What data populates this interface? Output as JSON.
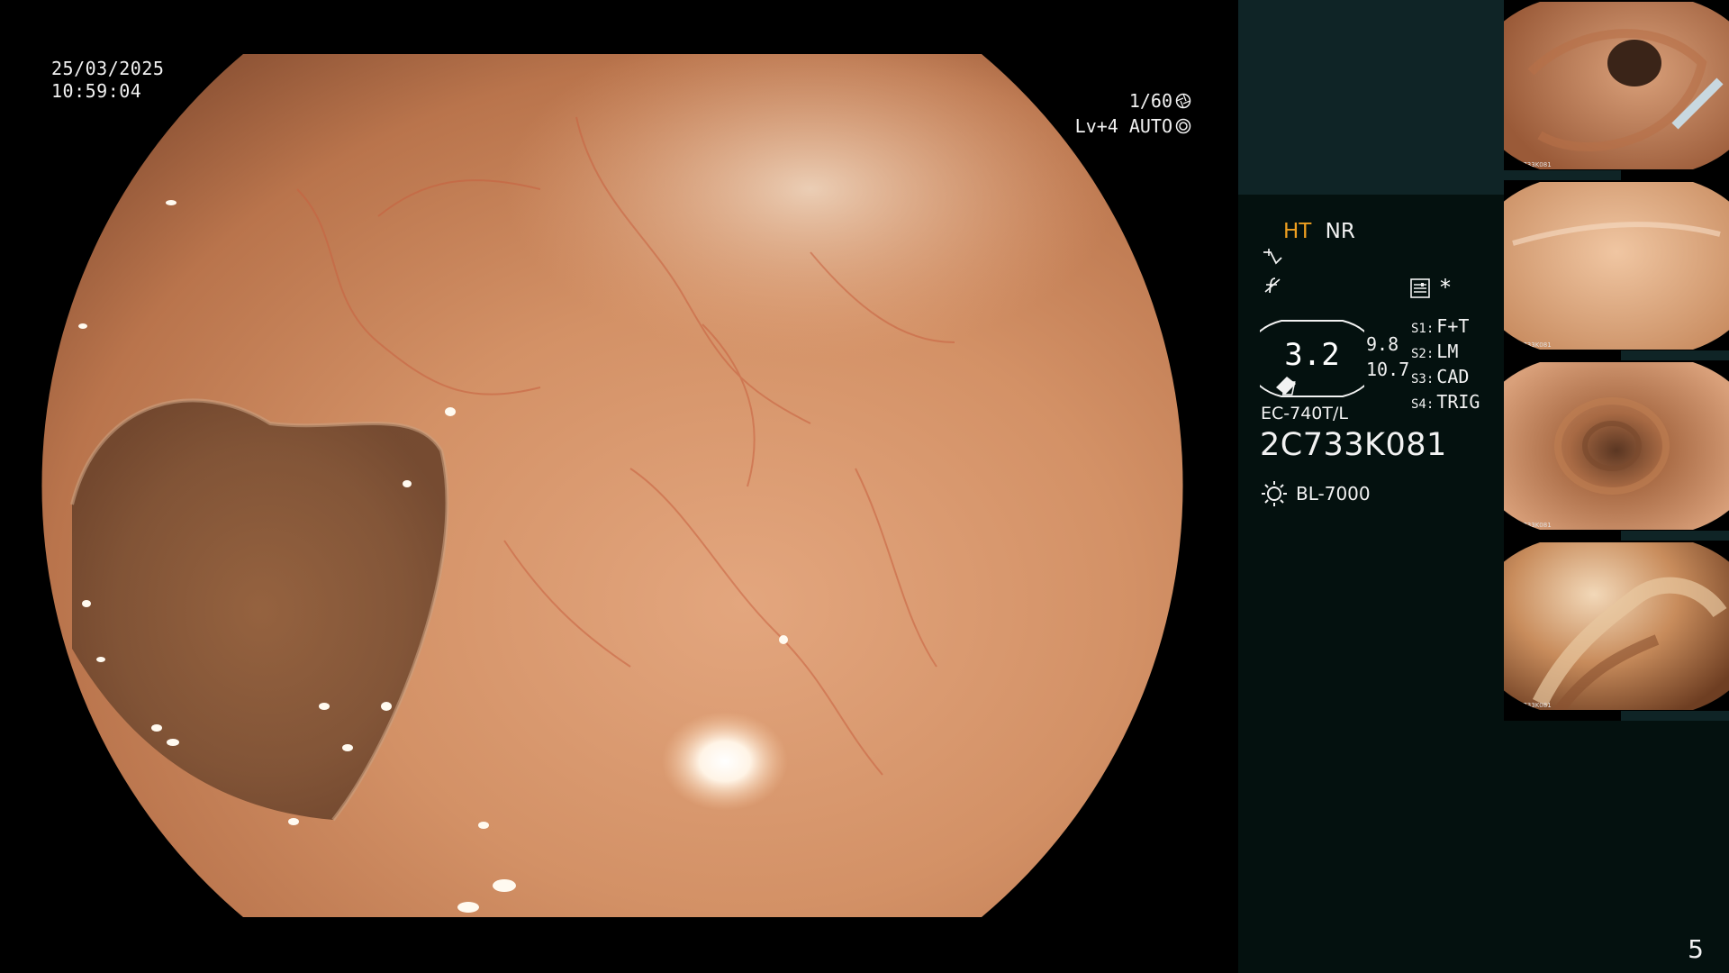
{
  "main": {
    "date": "25/03/2025",
    "time": "10:59:04",
    "shutter": "1/60",
    "shutter_icon": "aperture-icon",
    "level": "Lv+4",
    "mode": "AUTO",
    "mode_icon": "iris-icon"
  },
  "side": {
    "header_color": "#0f2426",
    "panel_color": "#04110f",
    "mode_ht": "HT",
    "mode_nr": "NR",
    "ht_color": "#f0a020",
    "icons": [
      "wave-icon",
      "f-not-icon",
      "menu-list-icon"
    ],
    "star": "*",
    "gauge_value": "3.2",
    "gauge_top": "9.8",
    "gauge_bottom": "10.7",
    "switches": [
      {
        "key": "S1:",
        "value": "F+T"
      },
      {
        "key": "S2:",
        "value": "LM"
      },
      {
        "key": "S3:",
        "value": "CAD"
      },
      {
        "key": "S4:",
        "value": "TRIG"
      }
    ],
    "scope_model": "EC-740T/L",
    "scope_serial": "2C733K081",
    "light_source": "BL-7000",
    "light_icon": "light-source-icon"
  },
  "thumbnails": [
    {
      "id": 1,
      "scope_serial": "2C733K081"
    },
    {
      "id": 2,
      "scope_serial": "2C733K081"
    },
    {
      "id": 3,
      "scope_serial": "2C733K081"
    },
    {
      "id": 4,
      "scope_serial": "2C733K081"
    }
  ],
  "page_number": "5"
}
